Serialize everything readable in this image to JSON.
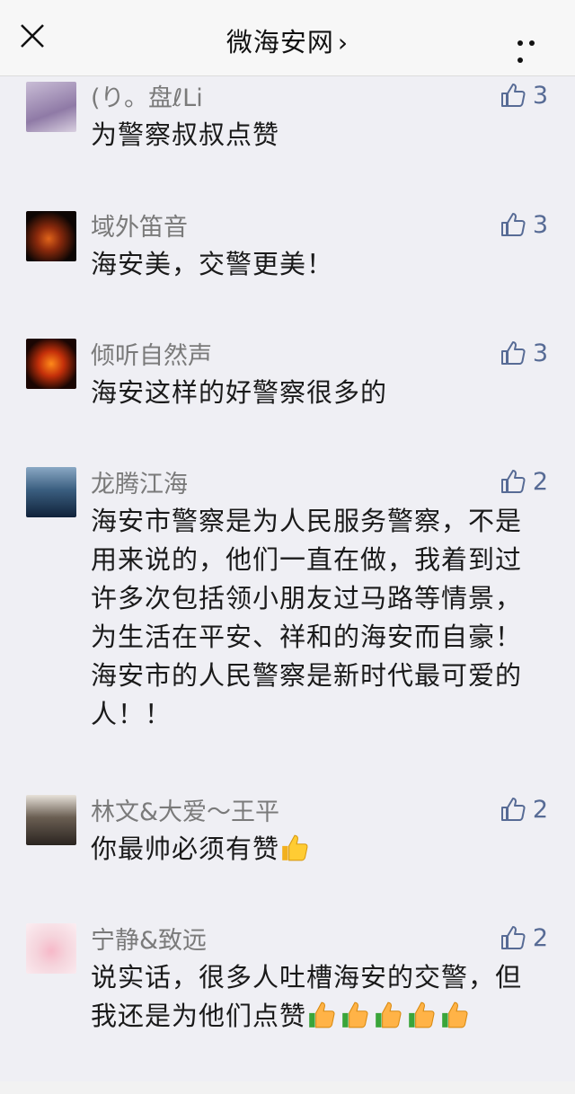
{
  "header": {
    "title": "微海安网",
    "chevron": "›",
    "close_icon": "close-icon",
    "more_icon": "more-icon"
  },
  "comments": [
    {
      "name": "(り。盘ℓLi",
      "likes": "3",
      "text": "为警察叔叔点赞",
      "avatar_color": "#b8a8c8"
    },
    {
      "name": "域外笛音",
      "likes": "3",
      "text": "海安美，交警更美！",
      "avatar_color": "#1a0f0a"
    },
    {
      "name": "倾听自然声",
      "likes": "3",
      "text": "海安这样的好警察很多的",
      "avatar_color": "#140805"
    },
    {
      "name": "龙腾江海",
      "likes": "2",
      "text": "海安市警察是为人民服务警察，不是用来说的，他们一直在做，我着到过许多次包括领小朋友过马路等情景，为生活在平安、祥和的海安而自豪！海安市的人民警察是新时代最可爱的人！！",
      "avatar_color": "#3a5a7a"
    },
    {
      "name": "林文&大爱～王平",
      "likes": "2",
      "text": "你最帅必须有赞",
      "avatar_color": "#d8d0c8"
    },
    {
      "name": "宁静&致远",
      "likes": "2",
      "text": "说实话，很多人吐槽海安的交警，但我还是为他们点赞",
      "avatar_color": "#f4d8e0"
    }
  ],
  "colors": {
    "like_count": "#576b95",
    "name": "#7a7a7a",
    "background": "#efeff4"
  }
}
